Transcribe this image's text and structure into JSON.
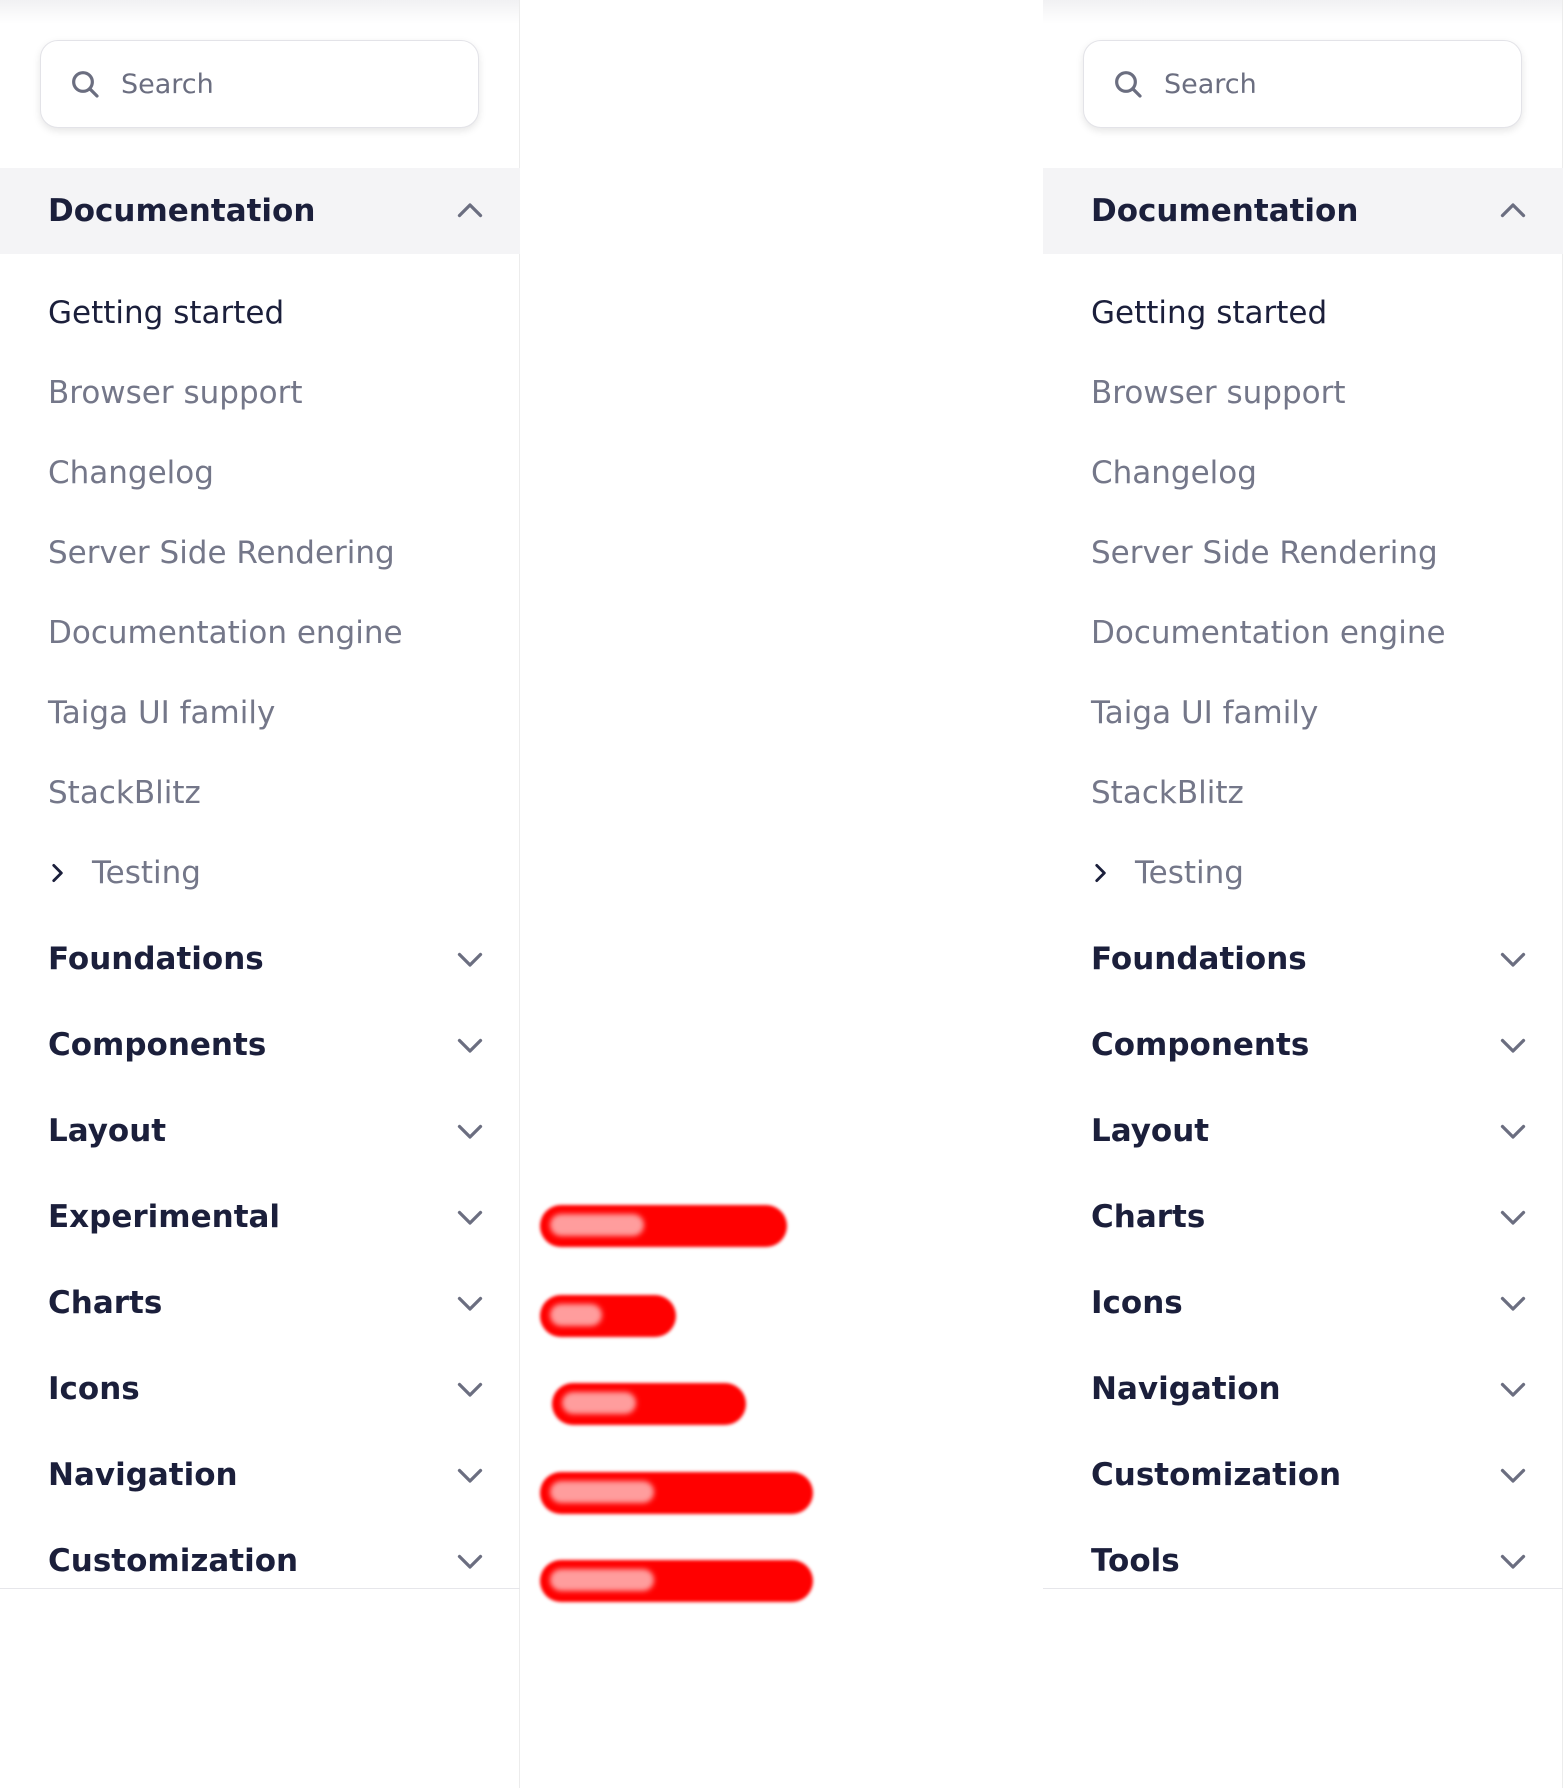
{
  "search": {
    "label": "Search"
  },
  "left_panel": {
    "section": {
      "label": "Documentation",
      "expanded": true
    },
    "items": [
      {
        "label": "Getting started",
        "active": true
      },
      {
        "label": "Browser support"
      },
      {
        "label": "Changelog"
      },
      {
        "label": "Server Side Rendering"
      },
      {
        "label": "Documentation engine"
      },
      {
        "label": "Taiga UI family"
      },
      {
        "label": "StackBlitz"
      }
    ],
    "sub_item": {
      "label": "Testing"
    },
    "categories": [
      "Foundations",
      "Components",
      "Layout",
      "Experimental",
      "Charts",
      "Icons",
      "Navigation",
      "Customization"
    ]
  },
  "right_panel": {
    "section": {
      "label": "Documentation",
      "expanded": true
    },
    "items": [
      {
        "label": "Getting started",
        "active": true
      },
      {
        "label": "Browser support"
      },
      {
        "label": "Changelog"
      },
      {
        "label": "Server Side Rendering"
      },
      {
        "label": "Documentation engine"
      },
      {
        "label": "Taiga UI family"
      },
      {
        "label": "StackBlitz"
      }
    ],
    "sub_item": {
      "label": "Testing"
    },
    "categories": [
      "Foundations",
      "Components",
      "Layout",
      "Charts",
      "Icons",
      "Navigation",
      "Customization",
      "Tools"
    ]
  },
  "redacted_diff": {
    "count": 5,
    "color": "#ff0000"
  },
  "colors": {
    "text_dark": "#1b1f3b",
    "text_muted": "#747789",
    "section_bg": "#f4f4f6"
  }
}
